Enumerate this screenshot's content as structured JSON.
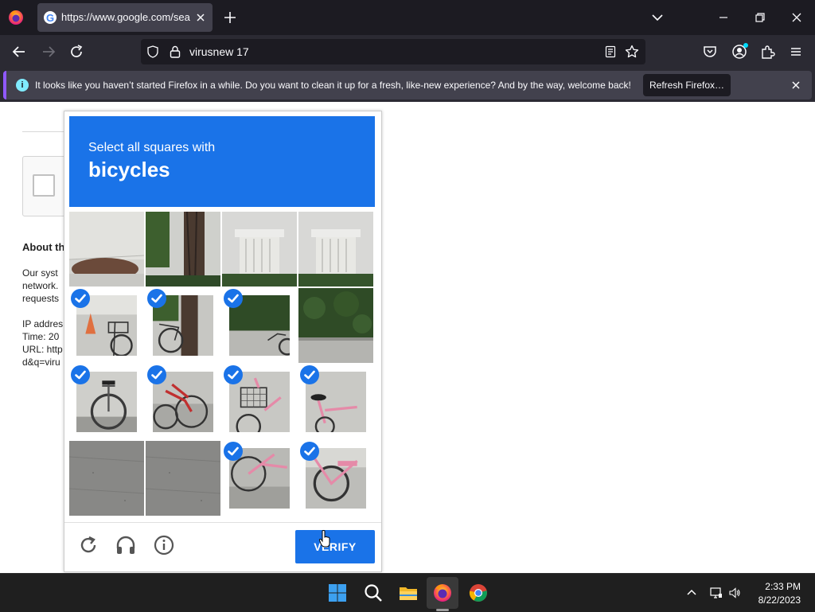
{
  "browser": {
    "tab": {
      "title": "https://www.google.com/search"
    },
    "urlbar": {
      "text": "virusnew 17"
    },
    "notification": {
      "message": "It looks like you haven’t started Firefox in a while. Do you want to clean it up for a fresh, like-new experience? And by the way, welcome back!",
      "button_label": "Refresh Firefox…"
    },
    "colors": {
      "accent": "#9059ff",
      "chrome_dark": "#1c1b22",
      "chrome": "#2b2a33"
    }
  },
  "background_page": {
    "about_heading": "About th",
    "lines": [
      "Our syst",
      "network.",
      "requests",
      "IP addres",
      "Time: 20",
      "URL: http",
      "d&q=viru"
    ]
  },
  "captcha": {
    "instruction": "Select all squares with",
    "target": "bicycles",
    "verify_label": "VERIFY",
    "accent_color": "#1a73e8",
    "tiles": [
      {
        "selected": false,
        "content": "wall-shrub"
      },
      {
        "selected": false,
        "content": "tree-trunk"
      },
      {
        "selected": false,
        "content": "pillar"
      },
      {
        "selected": false,
        "content": "pillar"
      },
      {
        "selected": true,
        "content": "bicycle-cone"
      },
      {
        "selected": true,
        "content": "bicycle-tree"
      },
      {
        "selected": true,
        "content": "bicycle-hedge"
      },
      {
        "selected": false,
        "content": "hedge"
      },
      {
        "selected": true,
        "content": "bicycle-silver"
      },
      {
        "selected": true,
        "content": "bicycle-red"
      },
      {
        "selected": true,
        "content": "bicycle-pink-basket"
      },
      {
        "selected": true,
        "content": "bicycle-pink-seat"
      },
      {
        "selected": false,
        "content": "pavement"
      },
      {
        "selected": false,
        "content": "pavement"
      },
      {
        "selected": true,
        "content": "bicycle-pink-wheel"
      },
      {
        "selected": true,
        "content": "bicycle-pink-rear"
      }
    ],
    "controls": [
      "reload-icon",
      "headphones-icon",
      "info-icon"
    ]
  },
  "taskbar": {
    "icons": [
      "windows-start-icon",
      "search-icon",
      "file-explorer-icon",
      "firefox-icon",
      "chrome-icon"
    ],
    "tray_icons": [
      "chevron-up-icon",
      "network-icon",
      "volume-icon"
    ],
    "clock": {
      "time": "2:33 PM",
      "date": "8/22/2023"
    }
  }
}
